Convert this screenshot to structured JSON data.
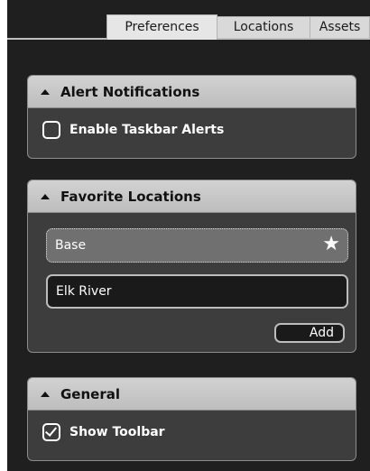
{
  "tabs": [
    {
      "label": "Preferences",
      "active": true
    },
    {
      "label": "Locations",
      "active": false
    },
    {
      "label": "Assets",
      "active": false
    }
  ],
  "alerts": {
    "title": "Alert Notifications",
    "checkbox_label": "Enable Taskbar Alerts",
    "checked": false
  },
  "favorites": {
    "title": "Favorite Locations",
    "items": [
      {
        "label": "Base",
        "favorite": true
      },
      {
        "label": "Elk River",
        "favorite": false
      }
    ],
    "add_label": "Add"
  },
  "general": {
    "title": "General",
    "checkbox_label": "Show Toolbar",
    "checked": true
  },
  "icons": {
    "collapse": "triangle-up-icon",
    "star": "star-icon"
  },
  "colors": {
    "background": "#1f1f1f",
    "panel": "#3d3d3d",
    "header": "#c8c8c8",
    "selected_item": "#707070"
  }
}
